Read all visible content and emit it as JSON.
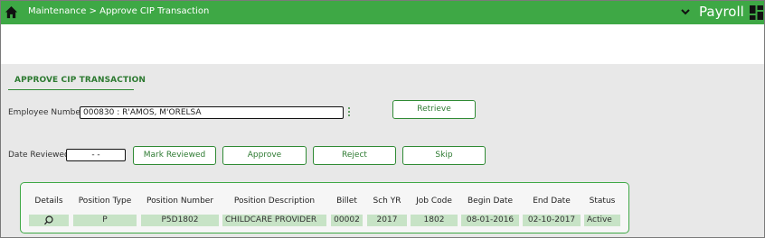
{
  "header": {
    "breadcrumb": "Maintenance > Approve CIP Transaction",
    "app_name": "Payroll",
    "brand_color": "#3ea845"
  },
  "page": {
    "title": "APPROVE CIP TRANSACTION"
  },
  "form": {
    "employee_label": "Employee Number:",
    "employee_value": "000830 : R'AMOS, M'ORELSA",
    "retrieve_label": "Retrieve",
    "date_label": "Date Reviewed:",
    "date_value": "- -",
    "mark_reviewed_label": "Mark Reviewed",
    "approve_label": "Approve",
    "reject_label": "Reject",
    "skip_label": "Skip"
  },
  "table": {
    "columns": [
      "Details",
      "Position Type",
      "Position Number",
      "Position Description",
      "Billet",
      "Sch YR",
      "Job Code",
      "Begin Date",
      "End Date",
      "Status"
    ],
    "rows": [
      {
        "details_icon": "search-icon",
        "position_type": "P",
        "position_number": "P5D1802",
        "position_description": "CHILDCARE PROVIDER",
        "billet": "00002",
        "sch_yr": "2017",
        "job_code": "1802",
        "begin_date": "08-01-2016",
        "end_date": "02-10-2017",
        "status": "Active"
      }
    ]
  }
}
